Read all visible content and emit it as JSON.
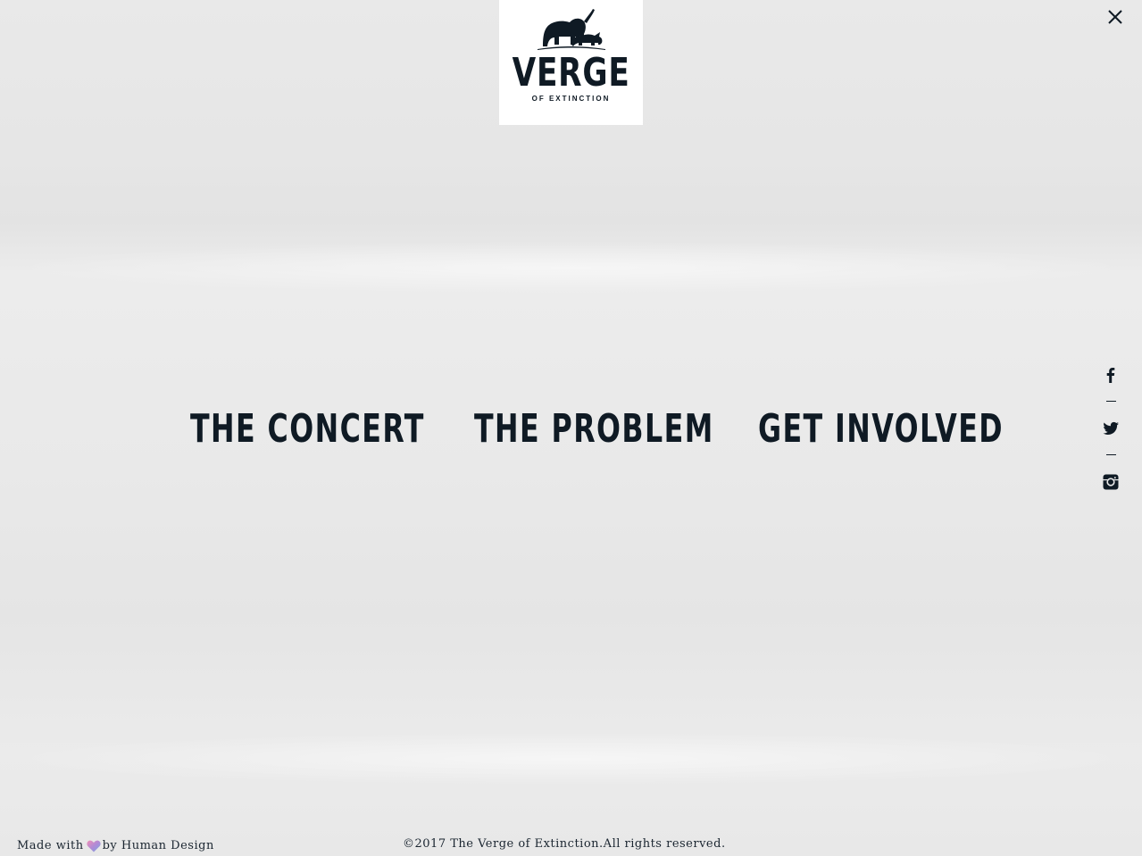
{
  "logo": {
    "word": "VERGE",
    "sub": "OF EXTINCTION",
    "icon": "elephant-rhino-logo-icon"
  },
  "close": {
    "icon": "close-icon"
  },
  "nav": {
    "items": [
      {
        "label": "THE CONCERT"
      },
      {
        "label": "THE PROBLEM"
      },
      {
        "label": "GET INVOLVED"
      }
    ]
  },
  "social": {
    "icons": [
      "facebook-icon",
      "twitter-icon",
      "instagram-icon"
    ]
  },
  "footer": {
    "made_prefix": "Made with",
    "made_suffix": "by Human Design",
    "copyright": "©2017 The Verge of Extinction.All rights reserved."
  },
  "colors": {
    "text": "#0f1a24",
    "background": "#e8e8e8",
    "logo_bg": "#ffffff"
  }
}
